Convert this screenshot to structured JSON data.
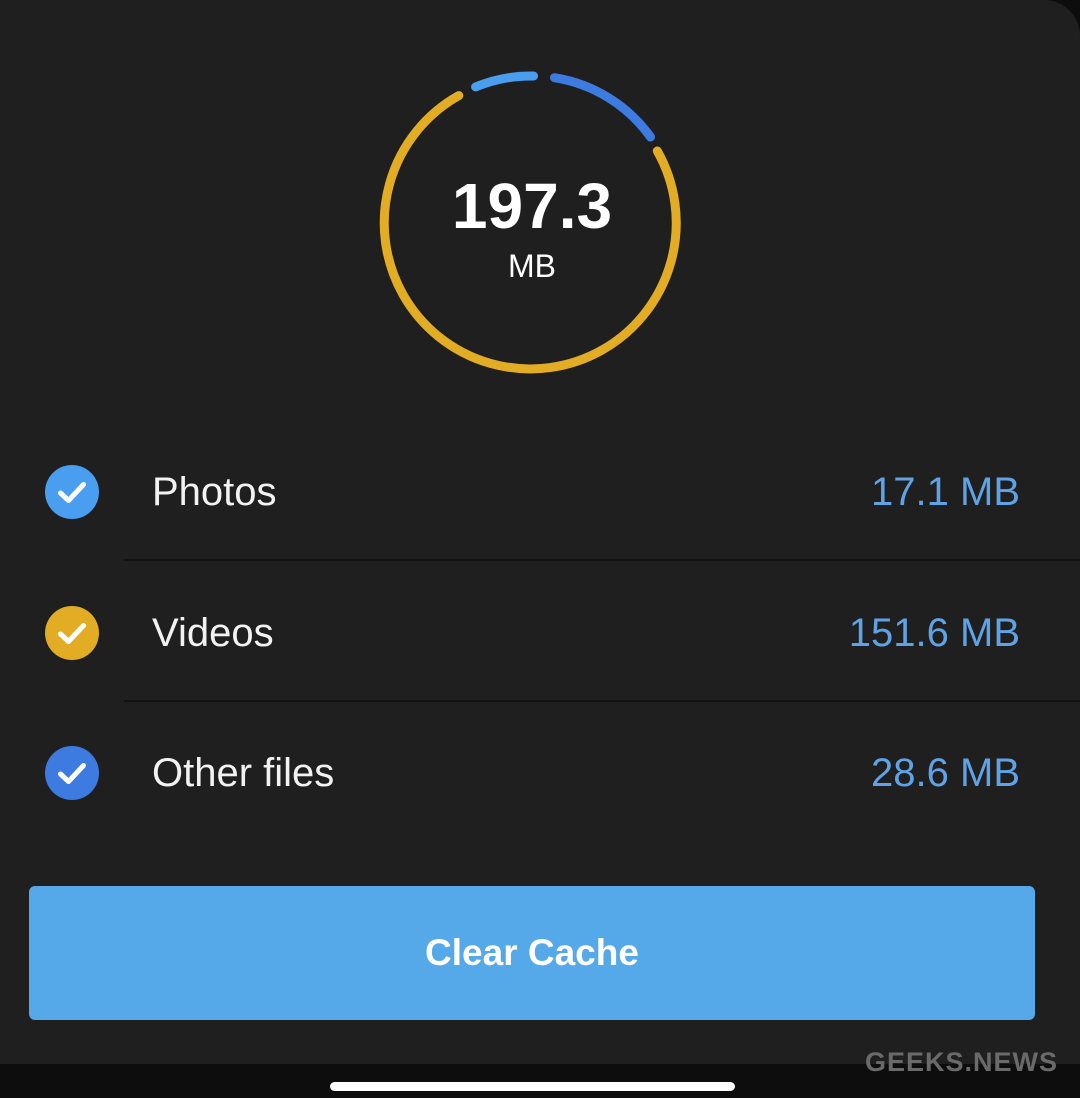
{
  "total": {
    "value": "197.3",
    "unit": "MB"
  },
  "categories": [
    {
      "label": "Photos",
      "size": "17.1 MB",
      "checked": true,
      "color": "#4a9ef0"
    },
    {
      "label": "Videos",
      "size": "151.6 MB",
      "checked": true,
      "color": "#e3ac25"
    },
    {
      "label": "Other files",
      "size": "28.6 MB",
      "checked": true,
      "color": "#3d7be0"
    }
  ],
  "actions": {
    "clear_cache_label": "Clear Cache"
  },
  "watermark": "GEEKS.NEWS",
  "colors": {
    "background": "#1f1f1f",
    "accent_button": "#55a9e9",
    "size_text": "#5fa3e6",
    "photos": "#4a9ef0",
    "videos": "#e3ac25",
    "other_files": "#3d7be0"
  }
}
